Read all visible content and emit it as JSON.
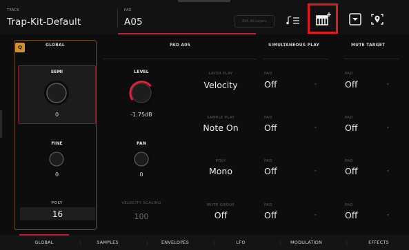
{
  "header": {
    "track_caption": "TRACK",
    "track_value": "Trap-Kit-Default",
    "pad_caption": "PAD",
    "pad_value": "A05",
    "edit_layers": "Edit All Layers",
    "icons": [
      "note-list-icon",
      "pad-keys-icon",
      "save-download-icon",
      "pin-locate-icon"
    ]
  },
  "sections": {
    "global": "GLOBAL",
    "pad": "PAD A05",
    "simultaneous": "SIMULTANEOUS PLAY",
    "mute": "MUTE TARGET",
    "q_badge": "Q"
  },
  "global": {
    "semi_label": "SEMI",
    "semi_value": "0",
    "fine_label": "FINE",
    "fine_value": "0",
    "poly_label": "POLY",
    "poly_value": "16"
  },
  "pad_params": {
    "level_label": "LEVEL",
    "level_value": "-1.75dB",
    "pan_label": "PAN",
    "pan_value": "0",
    "velocity_scaling_label": "VELOCITY SCALING",
    "velocity_scaling_value": "100"
  },
  "settings": {
    "layer_play_caption": "LAYER PLAY",
    "layer_play_value": "Velocity",
    "sample_play_caption": "SAMPLE PLAY",
    "sample_play_value": "Note On",
    "poly_caption": "POLY",
    "poly_value": "Mono",
    "mute_group_caption": "MUTE GROUP",
    "mute_group_value": "Off"
  },
  "simultaneous_play": [
    {
      "caption": "PAD",
      "value": "Off"
    },
    {
      "caption": "PAD",
      "value": "Off"
    },
    {
      "caption": "PAD",
      "value": "Off"
    },
    {
      "caption": "PAD",
      "value": "Off"
    }
  ],
  "mute_target": [
    {
      "caption": "PAD",
      "value": "Off"
    },
    {
      "caption": "PAD",
      "value": "Off"
    },
    {
      "caption": "PAD",
      "value": "Off"
    },
    {
      "caption": "PAD",
      "value": "Off"
    }
  ],
  "tabs": [
    "GLOBAL",
    "SAMPLES",
    "ENVELOPES",
    "LFO",
    "MODULATION",
    "EFFECTS"
  ],
  "active_tab": "GLOBAL",
  "colors": {
    "accent_red": "#c41f3a",
    "highlight_box": "#e01b1b",
    "global_border": "#6e5217",
    "q_badge": "#d3912a",
    "level_arc": "#e0203c"
  }
}
